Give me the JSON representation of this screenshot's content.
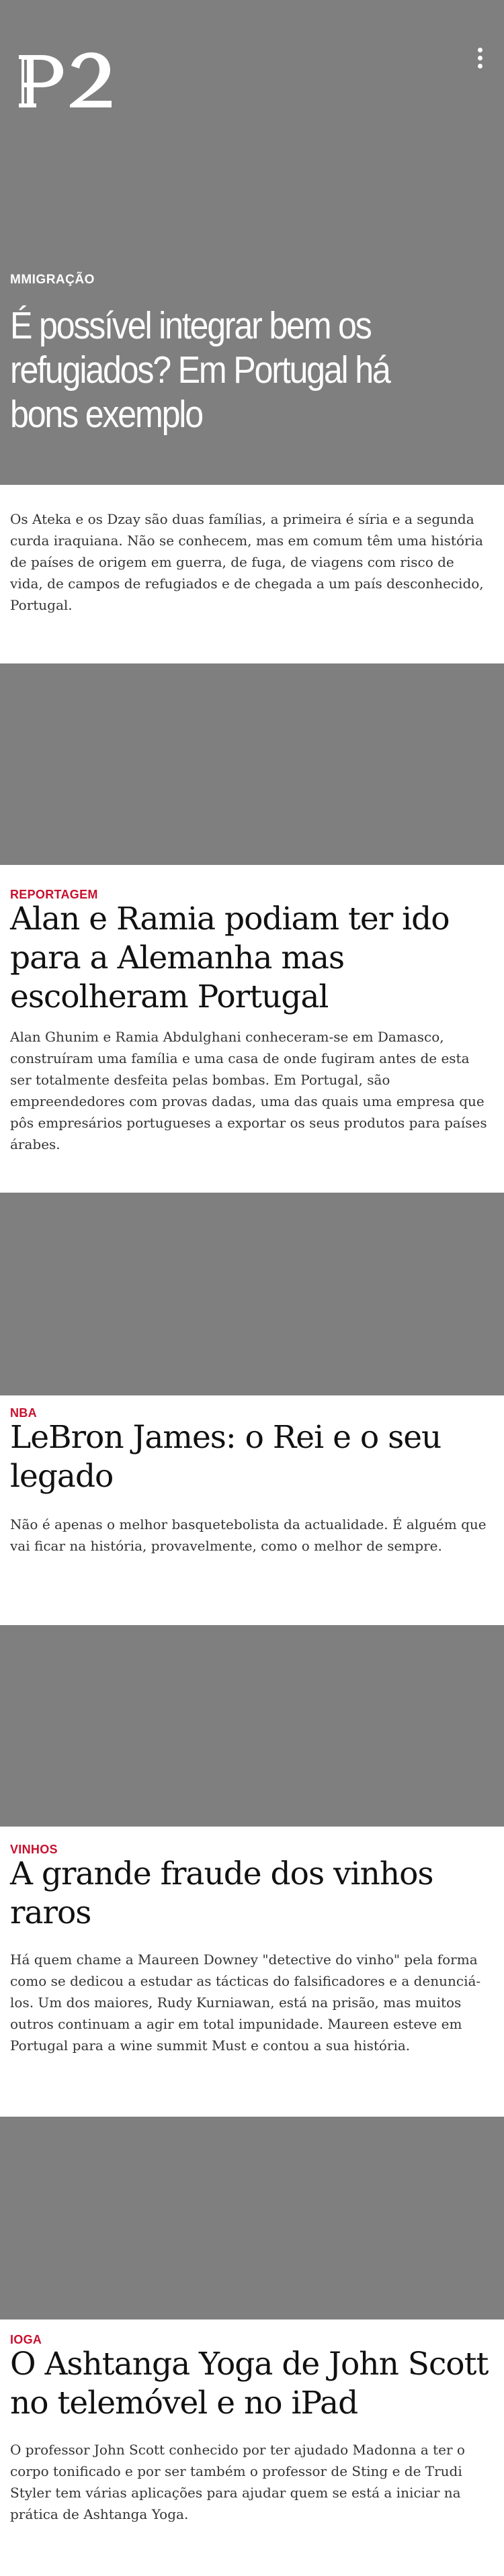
{
  "header": {
    "logo_text": "P2",
    "menu_icon": "more-vertical-icon"
  },
  "hero": {
    "category": "MMIGRAÇÃO",
    "title": "É possível integrar bem os refugiados? Em Portugal há bons exemplo",
    "lead": "Os Ateka e os Dzay são duas famílias, a primeira é síria e a segunda curda iraquiana. Não se conhecem, mas em comum têm uma história de países de origem em guerra, de fuga, de viagens com risco de vida, de campos de refugiados e de chegada a um país desconhecido, Portugal."
  },
  "articles": [
    {
      "category": "REPORTAGEM",
      "title": "Alan e Ramia podiam ter ido para a Alemanha mas escolheram Portugal",
      "lead": "Alan Ghunim e Ramia Abdulghani conheceram-se em Damasco, construíram uma família e uma casa de onde fugiram antes de esta ser totalmente desfeita pelas bombas. Em Portugal, são empreendedores com provas dadas, uma das quais uma empresa que pôs empresários portugueses a exportar os seus produtos para países árabes."
    },
    {
      "category": "NBA",
      "title": "LeBron James: o Rei e o seu legado",
      "lead": "Não é apenas o melhor basquetebolista da actualidade. É alguém que vai ficar na história, provavelmente, como o melhor de sempre."
    },
    {
      "category": "VINHOS",
      "title": "A grande fraude dos vinhos raros",
      "lead": "Há quem chame a Maureen Downey \"detective do vinho\" pela forma como se dedicou a estudar as tácticas do falsificadores e a denunciá-los. Um dos maiores, Rudy Kurniawan, está na prisão, mas muitos outros continuam a agir em total impunidade. Maureen esteve em Portugal para a wine summit Must e contou a sua história."
    },
    {
      "category": "IOGA",
      "title": "O Ashtanga Yoga de John Scott no telemóvel e no iPad",
      "lead": "O professor John Scott conhecido por ter ajudado Madonna a ter o corpo tonificado e por ser também o professor de Sting e de Trudi Styler tem várias aplicações para ajudar quem se está a iniciar na prática de Ashtanga Yoga."
    }
  ],
  "colors": {
    "placeholder_gray": "#7f7f7f",
    "category_red": "#c8102e",
    "hero_text": "#ffffff"
  }
}
